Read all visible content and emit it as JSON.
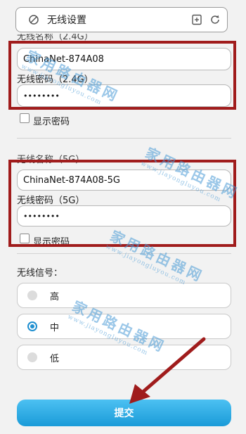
{
  "urlbar": {
    "title": "无线设置",
    "left_icon": "no-signal-icon",
    "bookmark_icon": "bookmark-plus-icon",
    "reload_icon": "reload-icon"
  },
  "wifi24": {
    "name_value": "ChinaNet-874A08",
    "password_label": "无线密码（2.4G）",
    "password_value": "••••••••",
    "show_password": "显示密码"
  },
  "wifi5": {
    "name_label": "无线名称（5G）",
    "name_value": "ChinaNet-874A08-5G",
    "password_label": "无线密码（5G）",
    "password_value": "••••••••",
    "show_password": "显示密码"
  },
  "signal": {
    "label": "无线信号：",
    "options": [
      {
        "label": "高",
        "selected": false
      },
      {
        "label": "中",
        "selected": true
      },
      {
        "label": "低",
        "selected": false
      }
    ]
  },
  "submit_label": "提交",
  "watermark": {
    "text": "家用路由器网",
    "url": "www.jiayongluyou.com"
  },
  "colors": {
    "accent": "#1e8fd0",
    "highlight_box": "#a01c1c",
    "arrow": "#a01c1c"
  }
}
